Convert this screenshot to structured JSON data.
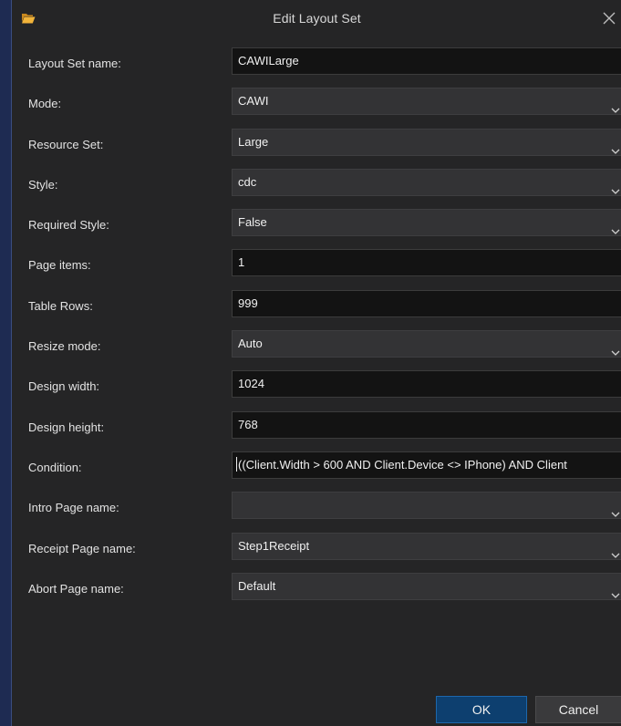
{
  "dialog": {
    "title": "Edit Layout Set",
    "icon": "folder-open-icon"
  },
  "fields": [
    {
      "label": "Layout Set name:",
      "type": "text",
      "value": "CAWILarge"
    },
    {
      "label": "Mode:",
      "type": "select",
      "value": "CAWI"
    },
    {
      "label": "Resource Set:",
      "type": "select",
      "value": "Large"
    },
    {
      "label": "Style:",
      "type": "select",
      "value": "cdc"
    },
    {
      "label": "Required Style:",
      "type": "select",
      "value": "False"
    },
    {
      "label": "Page items:",
      "type": "text",
      "value": "1"
    },
    {
      "label": "Table Rows:",
      "type": "text",
      "value": "999"
    },
    {
      "label": "Resize mode:",
      "type": "select",
      "value": "Auto"
    },
    {
      "label": "Design width:",
      "type": "text",
      "value": "1024"
    },
    {
      "label": "Design height:",
      "type": "text",
      "value": "768"
    },
    {
      "label": "Condition:",
      "type": "text",
      "value": "((Client.Width > 600 AND Client.Device <> IPhone) AND Client"
    },
    {
      "label": "Intro Page name:",
      "type": "select",
      "value": ""
    },
    {
      "label": "Receipt Page name:",
      "type": "select",
      "value": "Step1Receipt"
    },
    {
      "label": "Abort Page name:",
      "type": "select",
      "value": "Default"
    }
  ],
  "buttons": {
    "ok_label": "OK",
    "cancel_label": "Cancel"
  },
  "colors": {
    "background": "#1e2b52",
    "dialog": "#252526",
    "text_input": "#131313",
    "select_input": "#333335",
    "ok_button": "#0d3f6f"
  }
}
